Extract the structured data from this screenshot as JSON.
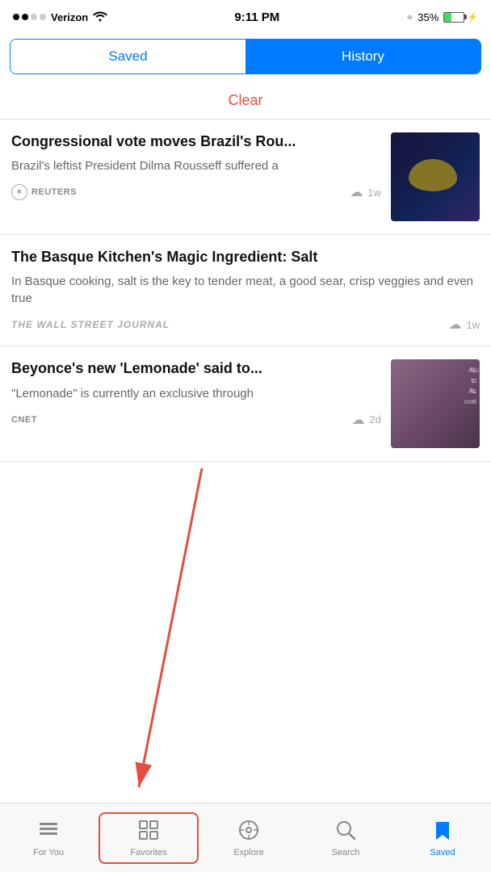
{
  "status_bar": {
    "carrier": "Verizon",
    "time": "9:11 PM",
    "battery_percent": "35%"
  },
  "segmented": {
    "saved_label": "Saved",
    "history_label": "History"
  },
  "clear_button": "Clear",
  "articles": [
    {
      "id": "article-1",
      "title": "Congressional vote moves Brazil's Rou...",
      "excerpt": "Brazil's leftist President Dilma Rousseff suffered a",
      "source": "REUTERS",
      "time_ago": "1w",
      "has_thumbnail": true,
      "thumbnail_type": "reuters"
    },
    {
      "id": "article-2",
      "title": "The Basque Kitchen's Magic Ingredient: Salt",
      "excerpt": "In Basque cooking, salt is the key to tender meat, a good sear, crisp veggies and even true",
      "source": "THE WALL STREET JOURNAL",
      "time_ago": "1w",
      "has_thumbnail": false,
      "thumbnail_type": null
    },
    {
      "id": "article-3",
      "title": "Beyonce's new 'Lemonade' said to...",
      "excerpt": "\"Lemonade\" is currently an exclusive through",
      "source": "cnet",
      "time_ago": "2d",
      "has_thumbnail": true,
      "thumbnail_type": "beyonce"
    }
  ],
  "tab_bar": {
    "tabs": [
      {
        "id": "for-you",
        "label": "For You",
        "icon": "☰♡",
        "active": false
      },
      {
        "id": "favorites",
        "label": "Favorites",
        "icon": "⊞",
        "active": false,
        "highlighted": true
      },
      {
        "id": "explore",
        "label": "Explore",
        "icon": "◎",
        "active": false
      },
      {
        "id": "search",
        "label": "Search",
        "icon": "⌕",
        "active": false
      },
      {
        "id": "saved",
        "label": "Saved",
        "icon": "🔖",
        "active": true
      }
    ]
  }
}
